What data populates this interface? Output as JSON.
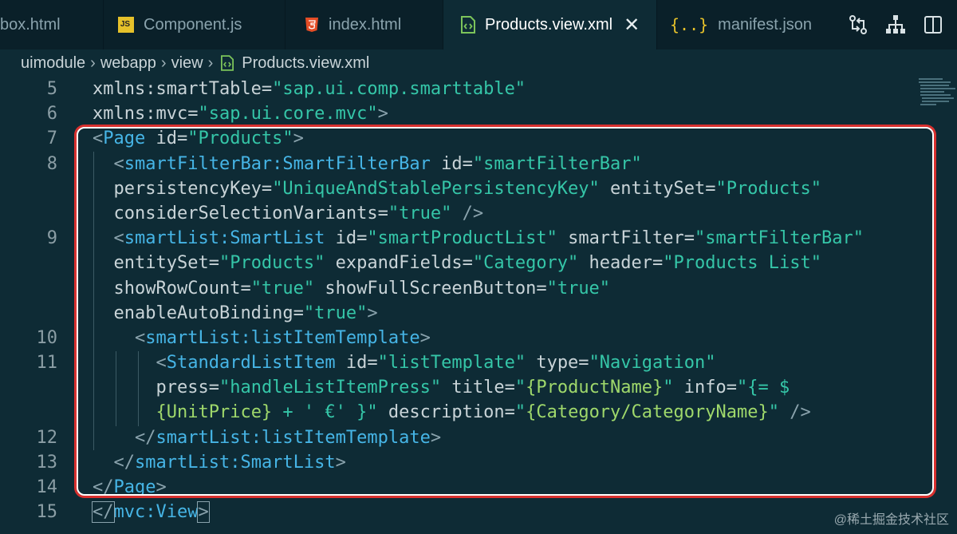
{
  "tabs": [
    {
      "label": "box.html",
      "icon": "html-file-icon",
      "active": false
    },
    {
      "label": "Component.js",
      "icon": "js-file-icon",
      "active": false
    },
    {
      "label": "index.html",
      "icon": "html5-icon",
      "active": false
    },
    {
      "label": "Products.view.xml",
      "icon": "xml-file-icon",
      "active": true
    },
    {
      "label": "manifest.json",
      "icon": "json-braces-icon",
      "active": false
    }
  ],
  "close_glyph": "✕",
  "actions": [
    "compare-changes-icon",
    "hierarchy-icon",
    "split-editor-icon"
  ],
  "breadcrumb": {
    "parts": [
      "uimodule",
      "webapp",
      "view"
    ],
    "file": "Products.view.xml"
  },
  "line_numbers": [
    "5",
    "6",
    "7",
    "8",
    "",
    "",
    "9",
    "",
    "",
    "",
    "10",
    "11",
    "",
    "",
    "12",
    "13",
    "14",
    "15"
  ],
  "code": {
    "l5": {
      "attr": "xmlns:smartTable=",
      "val": "\"sap.ui.comp.smarttable\""
    },
    "l6": {
      "attr": "xmlns:mvc=",
      "val": "\"sap.ui.core.mvc\"",
      "end": ">"
    },
    "l7": {
      "open": "<",
      "tag": "Page",
      "attr": " id=",
      "val": "\"Products\"",
      "end": ">"
    },
    "l8a": {
      "open": "<",
      "tag": "smartFilterBar:SmartFilterBar",
      "attr": " id=",
      "val": "\"smartFilterBar\""
    },
    "l8b": {
      "attr1": "persistencyKey=",
      "val1": "\"UniqueAndStablePersistencyKey\"",
      "attr2": " entitySet=",
      "val2": "\"Products\""
    },
    "l8c": {
      "attr": "considerSelectionVariants=",
      "val": "\"true\"",
      "end": " />"
    },
    "l9a": {
      "open": "<",
      "tag": "smartList:SmartList",
      "attr1": " id=",
      "val1": "\"smartProductList\"",
      "attr2": " smartFilter=",
      "val2": "\"smartFilterBar\""
    },
    "l9b": {
      "attr1": "entitySet=",
      "val1": "\"Products\"",
      "attr2": " expandFields=",
      "val2": "\"Category\"",
      "attr3": " header=",
      "val3": "\"Products List\""
    },
    "l9c": {
      "attr1": "showRowCount=",
      "val1": "\"true\"",
      "attr2": " showFullScreenButton=",
      "val2": "\"true\""
    },
    "l9d": {
      "attr": "enableAutoBinding=",
      "val": "\"true\"",
      "end": ">"
    },
    "l10": {
      "open": "<",
      "tag": "smartList:listItemTemplate",
      "end": ">"
    },
    "l11a": {
      "open": "<",
      "tag": "StandardListItem",
      "attr1": " id=",
      "val1": "\"listTemplate\"",
      "attr2": " type=",
      "val2": "\"Navigation\""
    },
    "l11b": {
      "attr1": "press=",
      "val1": "\"handleListItemPress\"",
      "attr2": " title=",
      "q1": "\"",
      "b1": "{ProductName}",
      "q2": "\"",
      "attr3": " info=",
      "val3": "\"{= $"
    },
    "l11c": {
      "b1": "{UnitPrice}",
      "mid": " + ' €' ",
      "close": "}\"",
      "attr": " description=",
      "q1": "\"",
      "b2": "{Category/CategoryName}",
      "q2": "\"",
      "end": " />"
    },
    "l12": {
      "open": "</",
      "tag": "smartList:listItemTemplate",
      "end": ">"
    },
    "l13": {
      "open": "</",
      "tag": "smartList:SmartList",
      "end": ">"
    },
    "l14": {
      "open": "</",
      "tag": "Page",
      "end": ">"
    },
    "l15": {
      "open": "</",
      "tag": "mvc:View",
      "end": ">"
    }
  },
  "watermark": "@稀土掘金技术社区",
  "colors": {
    "highlight_border": "#d8302e",
    "tag": "#46b5e6",
    "string": "#35c6a8",
    "background": "#0e2b35"
  }
}
